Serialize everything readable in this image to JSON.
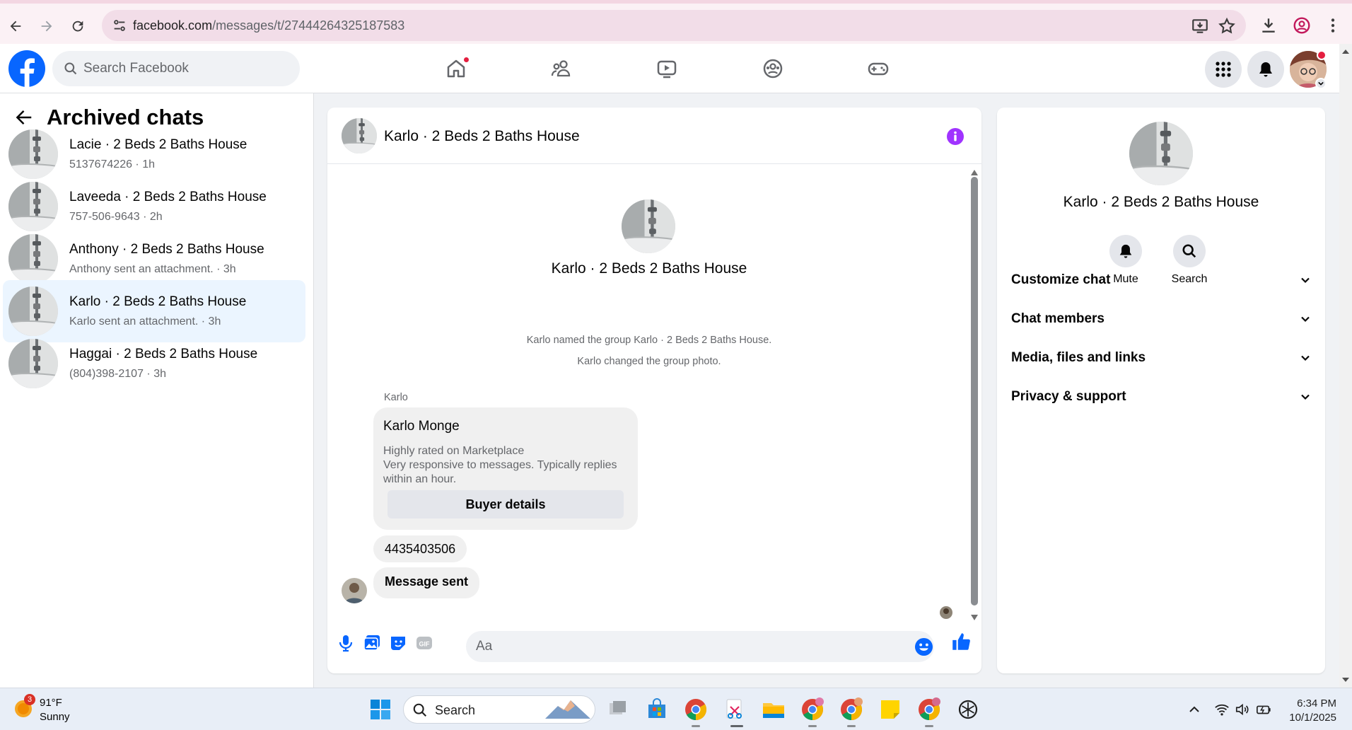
{
  "browser": {
    "url_host": "facebook.com",
    "url_path": "/messages/t/27444264325187583"
  },
  "topbar": {
    "search_placeholder": "Search Facebook"
  },
  "archived": {
    "title": "Archived chats",
    "items": [
      {
        "name": "Lacie · 2 Beds 2 Baths House",
        "sub": "5137674226 · 1h",
        "active": false
      },
      {
        "name": "Laveeda · 2 Beds 2 Baths House",
        "sub": "757-506-9643 · 2h",
        "active": false
      },
      {
        "name": "Anthony · 2 Beds 2 Baths House",
        "sub": "Anthony sent an attachment. · 3h",
        "active": false
      },
      {
        "name": "Karlo · 2 Beds 2 Baths House",
        "sub": "Karlo sent an attachment. · 3h",
        "active": true
      },
      {
        "name": "Haggai · 2 Beds 2 Baths House",
        "sub": "(804)398-2107 · 3h",
        "active": false
      }
    ]
  },
  "chat": {
    "title": "Karlo · 2 Beds 2 Baths House",
    "intro_title": "Karlo · 2 Beds 2 Baths House",
    "system_messages": [
      "Karlo named the group Karlo · 2 Beds 2 Baths House.",
      "Karlo changed the group photo."
    ],
    "sender_label": "Karlo",
    "card": {
      "name": "Karlo Monge",
      "line1": "Highly rated on Marketplace",
      "line2": "Very responsive to messages. Typically replies within an hour.",
      "button": "Buyer details"
    },
    "messages": [
      "4435403506",
      "Message sent"
    ],
    "input_placeholder": "Aa"
  },
  "details": {
    "name": "Karlo · 2 Beds 2 Baths House",
    "actions": [
      {
        "label": "Mute",
        "icon": "bell-icon"
      },
      {
        "label": "Search",
        "icon": "search-icon"
      }
    ],
    "sections": [
      "Customize chat",
      "Chat members",
      "Media, files and links",
      "Privacy & support"
    ]
  },
  "taskbar": {
    "weather_temp": "91°F",
    "weather_desc": "Sunny",
    "weather_badge": "3",
    "search_label": "Search",
    "time": "6:34 PM",
    "date": "10/1/2025"
  },
  "colors": {
    "fb_blue": "#0866ff",
    "messenger_purple": "#a033ff",
    "active_row": "#ebf5ff",
    "notification_red": "#e41e3f"
  }
}
